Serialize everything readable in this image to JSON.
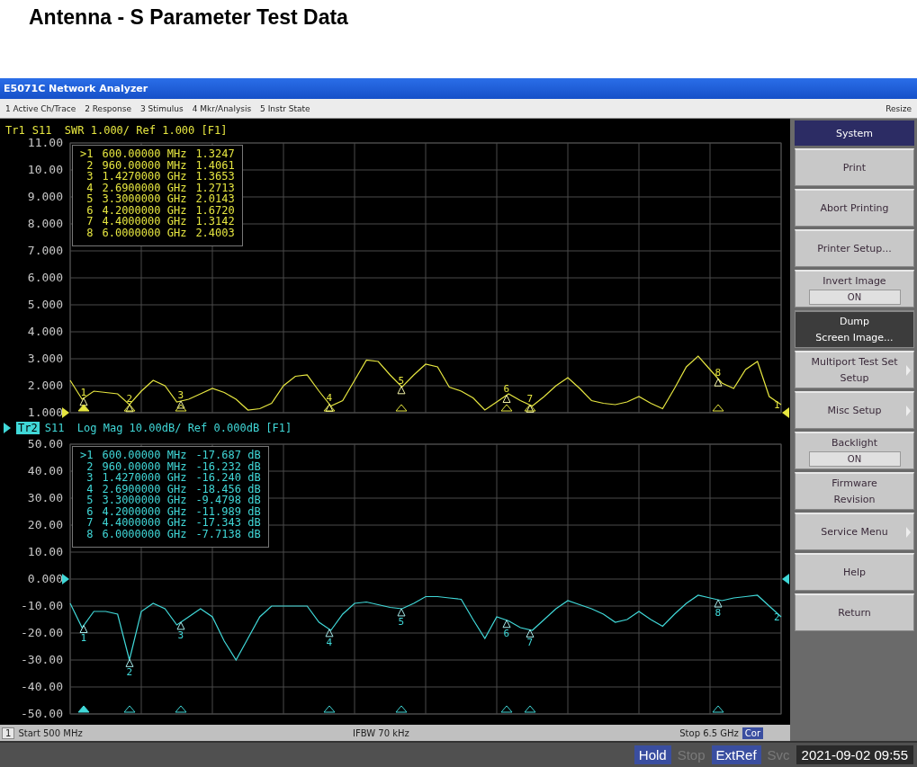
{
  "page_title": "Antenna - S Parameter Test Data",
  "window": {
    "title": "E5071C Network Analyzer"
  },
  "menu": {
    "items": [
      "1 Active Ch/Trace",
      "2 Response",
      "3 Stimulus",
      "4 Mkr/Analysis",
      "5 Instr State"
    ],
    "resize": "Resize"
  },
  "panels": [
    {
      "trace": "Tr1",
      "selected": false,
      "header": "S11  SWR 1.000/ Ref 1.000 [F1]",
      "end_label": "1",
      "chart_data": {
        "type": "line",
        "grid": true,
        "ylim": [
          1,
          11
        ],
        "yticks": [
          {
            "value": 11,
            "label": "11.00"
          },
          {
            "value": 10,
            "label": "10.00"
          },
          {
            "value": 9,
            "label": "9.000"
          },
          {
            "value": 8,
            "label": "8.000"
          },
          {
            "value": 7,
            "label": "7.000"
          },
          {
            "value": 6,
            "label": "6.000"
          },
          {
            "value": 5,
            "label": "5.000"
          },
          {
            "value": 4,
            "label": "4.000"
          },
          {
            "value": 3,
            "label": "3.000"
          },
          {
            "value": 2,
            "label": "2.000"
          },
          {
            "value": 1,
            "label": "1.000"
          }
        ],
        "categories": [
          null,
          null,
          null,
          null,
          null,
          null,
          null,
          null,
          null,
          null,
          null,
          null,
          null,
          null,
          null,
          null,
          null,
          null,
          null,
          null,
          null,
          null,
          null,
          null,
          null,
          null,
          null,
          null,
          null,
          null,
          null,
          null,
          null,
          null,
          null,
          null,
          null,
          null,
          null,
          null,
          null,
          null,
          null,
          null,
          null,
          null,
          null,
          null,
          null,
          null,
          null,
          null,
          null,
          null,
          null,
          null,
          null,
          null,
          null,
          null,
          null
        ],
        "series": [
          {
            "color": "#e6e640",
            "values": [
              2.2,
              1.5,
              1.8,
              1.75,
              1.7,
              1.3,
              1.8,
              2.2,
              2.0,
              1.4,
              1.5,
              1.7,
              1.9,
              1.75,
              1.5,
              1.1,
              1.15,
              1.35,
              2.0,
              2.35,
              2.4,
              1.8,
              1.25,
              1.45,
              2.2,
              2.95,
              2.9,
              2.4,
              1.95,
              2.4,
              2.8,
              2.7,
              1.95,
              1.8,
              1.55,
              1.1,
              1.4,
              1.7,
              1.45,
              1.25,
              1.6,
              2.0,
              2.3,
              1.9,
              1.45,
              1.35,
              1.3,
              1.4,
              1.6,
              1.35,
              1.15,
              1.9,
              2.7,
              3.1,
              2.6,
              2.1,
              1.9,
              2.6,
              2.9,
              1.6,
              1.3
            ]
          }
        ]
      },
      "markers": [
        {
          "marker": ">1",
          "stimulus": "600.00000 MHz",
          "response": "1.3247",
          "plot_label": "1"
        },
        {
          "marker": "2",
          "stimulus": "960.00000 MHz",
          "response": "1.4061",
          "plot_label": "2"
        },
        {
          "marker": "3",
          "stimulus": "1.4270000 GHz",
          "response": "1.3653",
          "plot_label": "3"
        },
        {
          "marker": "4",
          "stimulus": "2.6900000 GHz",
          "response": "1.2713",
          "plot_label": "4"
        },
        {
          "marker": "5",
          "stimulus": "3.3000000 GHz",
          "response": "2.0143",
          "plot_label": "5"
        },
        {
          "marker": "6",
          "stimulus": "4.2000000 GHz",
          "response": "1.6720",
          "plot_label": "6"
        },
        {
          "marker": "7",
          "stimulus": "4.4000000 GHz",
          "response": "1.3142",
          "plot_label": "7"
        },
        {
          "marker": "8",
          "stimulus": "6.0000000 GHz",
          "response": "2.4003",
          "plot_label": "8"
        }
      ]
    },
    {
      "trace": "Tr2",
      "selected": true,
      "header": "S11  Log Mag 10.00dB/ Ref 0.000dB [F1]",
      "end_label": "2",
      "chart_data": {
        "type": "line",
        "grid": true,
        "ylim": [
          -50,
          50
        ],
        "yticks": [
          {
            "value": 50,
            "label": "50.00"
          },
          {
            "value": 40,
            "label": "40.00"
          },
          {
            "value": 30,
            "label": "30.00"
          },
          {
            "value": 20,
            "label": "20.00"
          },
          {
            "value": 10,
            "label": "10.00"
          },
          {
            "value": 0,
            "label": "0.000"
          },
          {
            "value": -10,
            "label": "-10.00"
          },
          {
            "value": -20,
            "label": "-20.00"
          },
          {
            "value": -30,
            "label": "-30.00"
          },
          {
            "value": -40,
            "label": "-40.00"
          },
          {
            "value": -50,
            "label": "-50.00"
          }
        ],
        "categories": [
          null,
          null,
          null,
          null,
          null,
          null,
          null,
          null,
          null,
          null,
          null,
          null,
          null,
          null,
          null,
          null,
          null,
          null,
          null,
          null,
          null,
          null,
          null,
          null,
          null,
          null,
          null,
          null,
          null,
          null,
          null,
          null,
          null,
          null,
          null,
          null,
          null,
          null,
          null,
          null,
          null,
          null,
          null,
          null,
          null,
          null,
          null,
          null,
          null,
          null,
          null,
          null,
          null,
          null,
          null,
          null,
          null,
          null,
          null,
          null,
          null
        ],
        "series": [
          {
            "color": "#40d8d8",
            "values": [
              -9,
              -18,
              -12,
              -12,
              -13,
              -30,
              -12,
              -9,
              -11,
              -17,
              -14,
              -11,
              -14,
              -23,
              -30,
              -22,
              -14,
              -10,
              -10,
              -10,
              -10,
              -16,
              -19,
              -13,
              -9,
              -8.5,
              -9.5,
              -10.5,
              -11,
              -9,
              -6.5,
              -6.5,
              -7,
              -7.5,
              -15,
              -22,
              -14,
              -15.5,
              -18,
              -19,
              -15,
              -11,
              -8,
              -9.5,
              -11,
              -13,
              -16,
              -15,
              -12,
              -15,
              -17.5,
              -13,
              -9,
              -6,
              -7,
              -8,
              -7,
              -6.5,
              -6,
              -10,
              -14
            ]
          }
        ]
      },
      "markers": [
        {
          "marker": ">1",
          "stimulus": "600.00000 MHz",
          "response": "-17.687 dB",
          "plot_label": "1"
        },
        {
          "marker": "2",
          "stimulus": "960.00000 MHz",
          "response": "-16.232 dB",
          "plot_label": "2"
        },
        {
          "marker": "3",
          "stimulus": "1.4270000 GHz",
          "response": "-16.240 dB",
          "plot_label": "3"
        },
        {
          "marker": "4",
          "stimulus": "2.6900000 GHz",
          "response": "-18.456 dB",
          "plot_label": "4"
        },
        {
          "marker": "5",
          "stimulus": "3.3000000 GHz",
          "response": "-9.4798 dB",
          "plot_label": "5"
        },
        {
          "marker": "6",
          "stimulus": "4.2000000 GHz",
          "response": "-11.989 dB",
          "plot_label": "6"
        },
        {
          "marker": "7",
          "stimulus": "4.4000000 GHz",
          "response": "-17.343 dB",
          "plot_label": "7"
        },
        {
          "marker": "8",
          "stimulus": "6.0000000 GHz",
          "response": "-7.7138 dB",
          "plot_label": "8"
        }
      ]
    }
  ],
  "channel_status": {
    "channel": "1",
    "start": "Start 500 MHz",
    "ifbw": "IFBW 70 kHz",
    "stop": "Stop 6.5 GHz",
    "correction": "Cor"
  },
  "softkeys": [
    {
      "kind": "header",
      "label": "System"
    },
    {
      "kind": "button",
      "label": "Print",
      "selected": false,
      "submenu": false
    },
    {
      "kind": "button",
      "label": "Abort Printing",
      "selected": false,
      "submenu": false
    },
    {
      "kind": "button",
      "label": "Printer Setup...",
      "selected": false,
      "submenu": false
    },
    {
      "kind": "toggle",
      "label": "Invert Image",
      "value": "ON",
      "selected": false,
      "submenu": false
    },
    {
      "kind": "button",
      "label": "Dump\nScreen Image...",
      "selected": true,
      "submenu": false
    },
    {
      "kind": "button",
      "label": "Multiport Test Set\nSetup",
      "selected": false,
      "submenu": true
    },
    {
      "kind": "button",
      "label": "Misc Setup",
      "selected": false,
      "submenu": true
    },
    {
      "kind": "toggle",
      "label": "Backlight",
      "value": "ON",
      "selected": false,
      "submenu": false
    },
    {
      "kind": "button",
      "label": "Firmware\nRevision",
      "selected": false,
      "submenu": false
    },
    {
      "kind": "button",
      "label": "Service Menu",
      "selected": false,
      "submenu": true
    },
    {
      "kind": "button",
      "label": "Help",
      "selected": false,
      "submenu": false
    },
    {
      "kind": "button",
      "label": "Return",
      "selected": false,
      "submenu": false
    }
  ],
  "status_bar": {
    "indicators": [
      {
        "label": "Hold",
        "on": true
      },
      {
        "label": "Stop",
        "on": false
      },
      {
        "label": "ExtRef",
        "on": true
      },
      {
        "label": "Svc",
        "on": false
      }
    ],
    "datetime": "2021-09-02 09:55"
  }
}
